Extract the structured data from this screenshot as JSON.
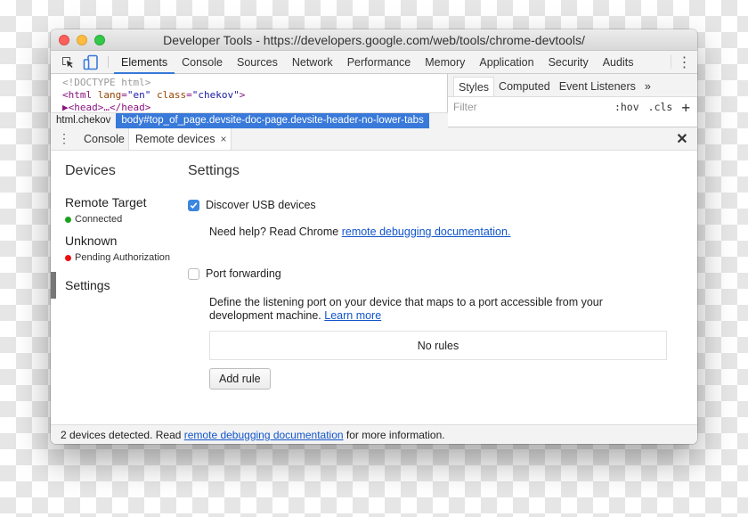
{
  "window": {
    "title": "Developer Tools - https://developers.google.com/web/tools/chrome-devtools/",
    "traffic_lights": {
      "close": "#fc605c",
      "minimize": "#fdbc40",
      "zoom": "#34c84a"
    }
  },
  "toolbar": {
    "icons": [
      "inspect-element-icon",
      "device-toolbar-icon"
    ],
    "tabs": [
      {
        "label": "Elements",
        "active": true
      },
      {
        "label": "Console"
      },
      {
        "label": "Sources"
      },
      {
        "label": "Network"
      },
      {
        "label": "Performance"
      },
      {
        "label": "Memory"
      },
      {
        "label": "Application"
      },
      {
        "label": "Security"
      },
      {
        "label": "Audits"
      }
    ],
    "more_icon": "⋮"
  },
  "dom_tree": {
    "doctype": "<!DOCTYPE html>",
    "html_open": "<html",
    "lang_attr": "lang",
    "lang_val": "\"en\"",
    "class_attr": "class",
    "class_val": "\"chekov\"",
    "html_close": ">",
    "head_line": "▶<head>…</head>"
  },
  "breadcrumbs": [
    {
      "label": "html.chekov"
    },
    {
      "label": "body#top_of_page.devsite-doc-page.devsite-header-no-lower-tabs",
      "selected": true
    }
  ],
  "styles_pane": {
    "tabs": [
      {
        "label": "Styles",
        "active": true
      },
      {
        "label": "Computed"
      },
      {
        "label": "Event Listeners"
      },
      {
        "label": "»"
      }
    ],
    "filter_placeholder": "Filter",
    "hov": ":hov",
    "cls": ".cls",
    "add": "+"
  },
  "drawer": {
    "kebab": "⋮",
    "tabs": [
      {
        "label": "Console"
      },
      {
        "label": "Remote devices",
        "active": true,
        "close": "×"
      }
    ],
    "close": "✕"
  },
  "sidebar": {
    "title": "Devices",
    "devices": [
      {
        "name": "Remote Target",
        "status": "Connected",
        "status_color": "#1aa31a"
      },
      {
        "name": "Unknown",
        "status": "Pending Authorization",
        "status_color": "#e8110f"
      }
    ],
    "settings_label": "Settings"
  },
  "settings": {
    "title": "Settings",
    "discover_usb": {
      "label": "Discover USB devices",
      "checked": true
    },
    "help_text": "Need help? Read Chrome ",
    "help_link": "remote debugging documentation.",
    "port_forwarding": {
      "label": "Port forwarding",
      "checked": false
    },
    "pf_description": "Define the listening port on your device that maps to a port accessible from your development machine. ",
    "learn_more": "Learn more",
    "no_rules": "No rules",
    "add_rule": "Add rule"
  },
  "status_bar": {
    "prefix": "2 devices detected. Read ",
    "link": "remote debugging documentation",
    "suffix": " for more information."
  }
}
